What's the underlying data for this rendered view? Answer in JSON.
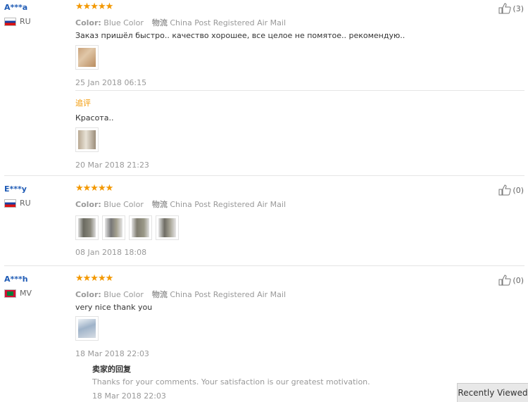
{
  "reviews": [
    {
      "user": "A***a",
      "country": "RU",
      "stars": "★★★★★",
      "color_label": "Color:",
      "color_value": "Blue Color",
      "shipping_label": "物流",
      "shipping_value": "China Post Registered Air Mail",
      "text": "Заказ пришёл быстро.. качество хорошее, все целое не помятое.. рекомендую..",
      "date": "25 Jan 2018 06:15",
      "likes": "(3)",
      "followup": {
        "label": "追评",
        "text": "Красота..",
        "date": "20 Mar 2018 21:23"
      }
    },
    {
      "user": "E***y",
      "country": "RU",
      "stars": "★★★★★",
      "color_label": "Color:",
      "color_value": "Blue Color",
      "shipping_label": "物流",
      "shipping_value": "China Post Registered Air Mail",
      "date": "08 Jan 2018 18:08",
      "likes": "(0)"
    },
    {
      "user": "A***h",
      "country": "MV",
      "stars": "★★★★★",
      "color_label": "Color:",
      "color_value": "Blue Color",
      "shipping_label": "物流",
      "shipping_value": "China Post Registered Air Mail",
      "text": "very nice thank you",
      "date": "18 Mar 2018 22:03",
      "likes": "(0)",
      "seller_reply": {
        "title": "卖家的回复",
        "text": "Thanks for your comments. Your satisfaction is our greatest motivation.",
        "date": "18 Mar 2018 22:03"
      }
    }
  ],
  "recently_viewed": "Recently Viewed"
}
